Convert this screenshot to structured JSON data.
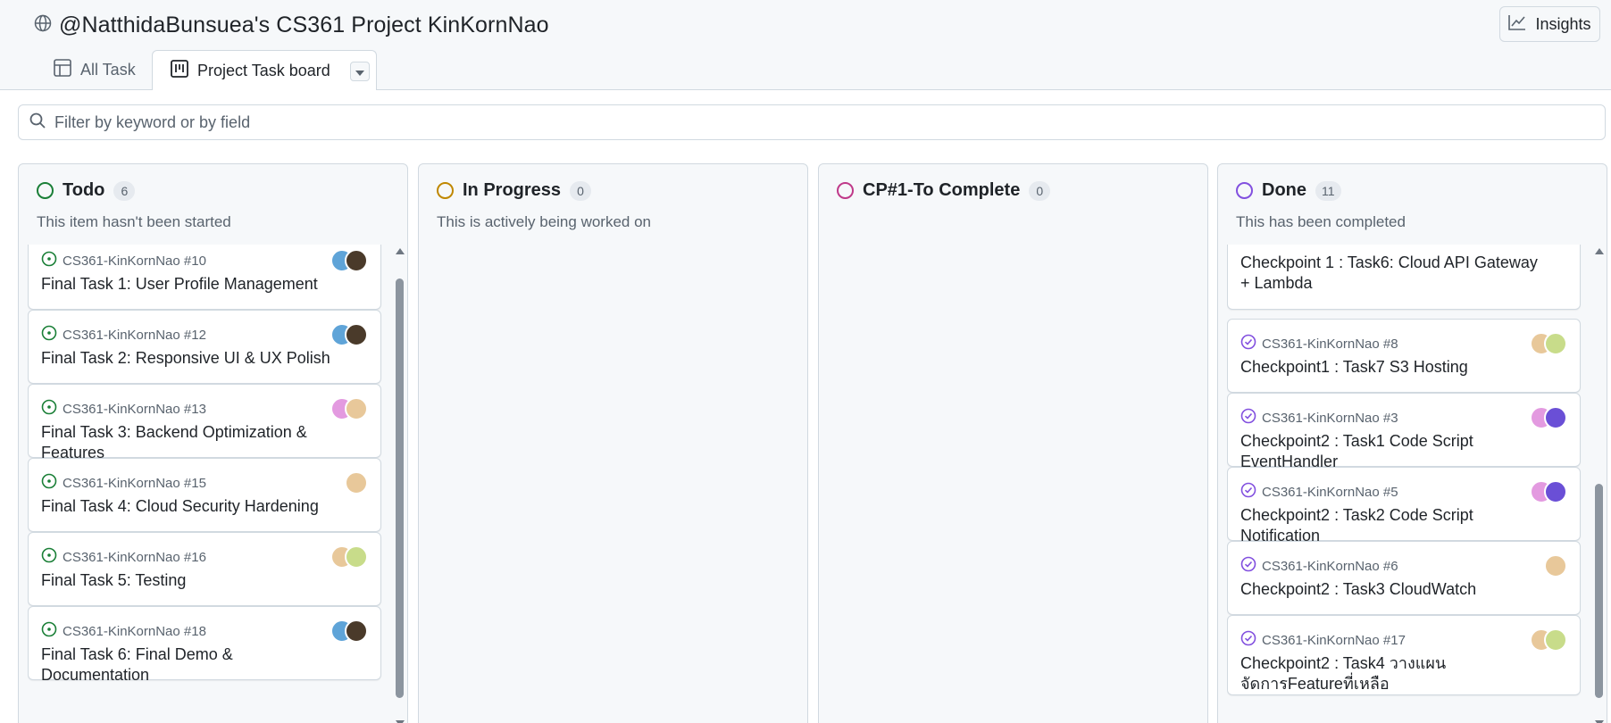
{
  "header": {
    "title": "@NatthidaBunsuea's CS361 Project KinKornNao",
    "insights_label": "Insights"
  },
  "tabs": [
    {
      "label": "All Task",
      "icon": "table-icon",
      "active": false
    },
    {
      "label": "Project Task board",
      "icon": "board-icon",
      "active": true
    }
  ],
  "filter": {
    "placeholder": "Filter by keyword or by field"
  },
  "columns": [
    {
      "name": "Todo",
      "count": "6",
      "description": "This item hasn't been started",
      "color": "#1a7f37",
      "cards": [
        {
          "ref": "CS361-KinKornNao #10",
          "title": "Final Task 1: User Profile Management"
        },
        {
          "ref": "CS361-KinKornNao #12",
          "title": "Final Task 2: Responsive UI & UX Polish"
        },
        {
          "ref": "CS361-KinKornNao #13",
          "title": "Final Task 3: Backend Optimization & Features"
        },
        {
          "ref": "CS361-KinKornNao #15",
          "title": "Final Task 4: Cloud Security Hardening"
        },
        {
          "ref": "CS361-KinKornNao #16",
          "title": "Final Task 5: Testing"
        },
        {
          "ref": "CS361-KinKornNao #18",
          "title": "Final Task 6: Final Demo & Documentation"
        }
      ]
    },
    {
      "name": "In Progress",
      "count": "0",
      "description": "This is actively being worked on",
      "color": "#bf8700",
      "cards": []
    },
    {
      "name": "CP#1-To Complete",
      "count": "0",
      "description": "",
      "color": "#bf3989",
      "cards": []
    },
    {
      "name": "Done",
      "count": "11",
      "description": "This has been completed",
      "color": "#8250df",
      "cards": [
        {
          "ref": "",
          "title": "Checkpoint 1 : Task6: Cloud API Gateway + Lambda"
        },
        {
          "ref": "CS361-KinKornNao #8",
          "title": "Checkpoint1 : Task7 S3 Hosting"
        },
        {
          "ref": "CS361-KinKornNao #3",
          "title": "Checkpoint2 : Task1 Code Script EventHandler"
        },
        {
          "ref": "CS361-KinKornNao #5",
          "title": "Checkpoint2 : Task2 Code Script Notification"
        },
        {
          "ref": "CS361-KinKornNao #6",
          "title": "Checkpoint2 : Task3 CloudWatch"
        },
        {
          "ref": "CS361-KinKornNao #17",
          "title": "Checkpoint2 : Task4 วางแผนจัดการFeatureที่เหลือ"
        }
      ]
    }
  ]
}
